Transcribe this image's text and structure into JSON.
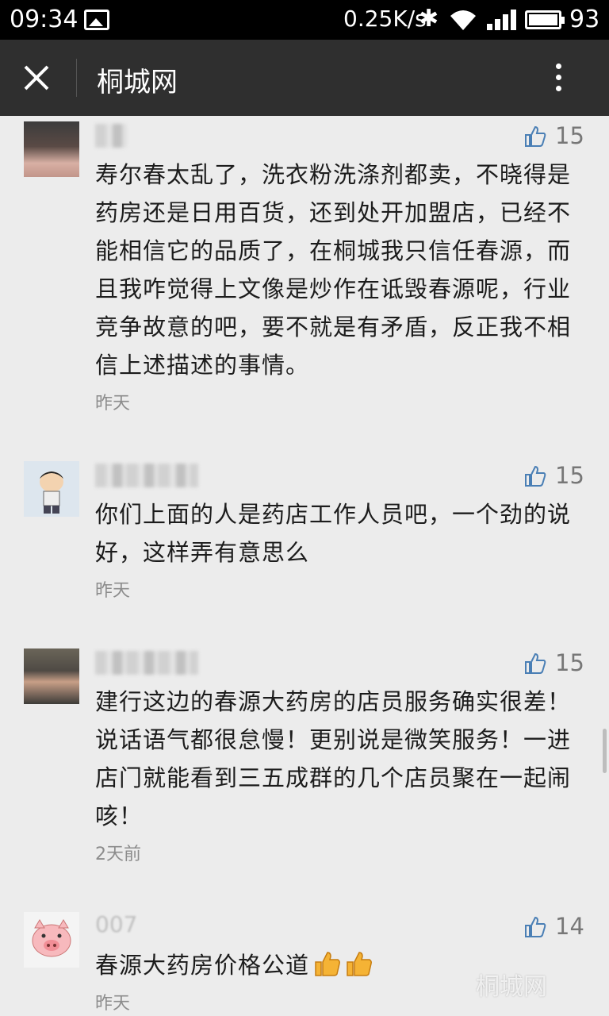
{
  "status_bar": {
    "time": "09:34",
    "net_speed": "0.25K/s",
    "battery": "93"
  },
  "title_bar": {
    "title": "桐城网"
  },
  "comments": [
    {
      "like_count": "15",
      "text": "寿尔春太乱了，洗衣粉洗涤剂都卖，不晓得是药房还是日用百货，还到处开加盟店，已经不能相信它的品质了，在桐城我只信任春源，而且我咋觉得上文像是炒作在诋毁春源呢，行业竞争故意的吧，要不就是有矛盾，反正我不相信上述描述的事情。",
      "time": "昨天"
    },
    {
      "like_count": "15",
      "text": "你们上面的人是药店工作人员吧，一个劲的说好，这样弄有意思么",
      "time": "昨天"
    },
    {
      "like_count": "15",
      "text": "建行这边的春源大药房的店员服务确实很差！说话语气都很怠慢！更别说是微笑服务！一进店门就能看到三五成群的几个店员聚在一起闹咳！",
      "time": "2天前"
    },
    {
      "name": "007",
      "like_count": "14",
      "text": "春源大药房价格公道",
      "time": "昨天"
    }
  ],
  "watermark": "桐城网"
}
